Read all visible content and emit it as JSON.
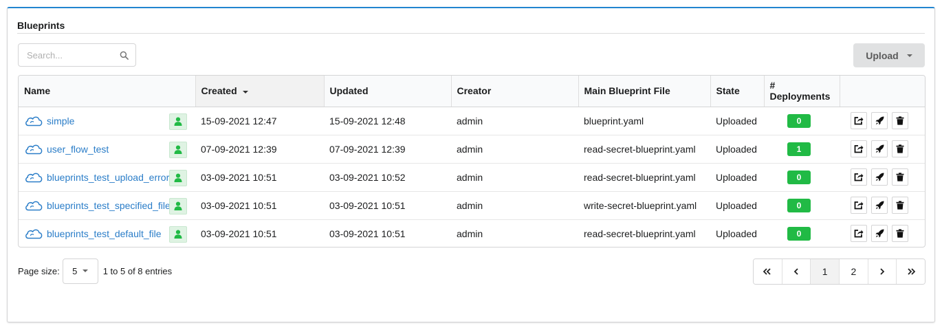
{
  "panel": {
    "title": "Blueprints"
  },
  "search": {
    "placeholder": "Search..."
  },
  "upload": {
    "label": "Upload"
  },
  "table": {
    "columns": [
      "Name",
      "Created",
      "Updated",
      "Creator",
      "Main Blueprint File",
      "State",
      "# Deployments"
    ],
    "sorted_column": "Created",
    "rows": [
      {
        "name": "simple",
        "created": "15-09-2021 12:47",
        "updated": "15-09-2021 12:48",
        "creator": "admin",
        "file": "blueprint.yaml",
        "state": "Uploaded",
        "deployments": "0"
      },
      {
        "name": "user_flow_test",
        "created": "07-09-2021 12:39",
        "updated": "07-09-2021 12:39",
        "creator": "admin",
        "file": "read-secret-blueprint.yaml",
        "state": "Uploaded",
        "deployments": "1"
      },
      {
        "name": "blueprints_test_upload_error",
        "created": "03-09-2021 10:51",
        "updated": "03-09-2021 10:52",
        "creator": "admin",
        "file": "read-secret-blueprint.yaml",
        "state": "Uploaded",
        "deployments": "0"
      },
      {
        "name": "blueprints_test_specified_file",
        "created": "03-09-2021 10:51",
        "updated": "03-09-2021 10:51",
        "creator": "admin",
        "file": "write-secret-blueprint.yaml",
        "state": "Uploaded",
        "deployments": "0"
      },
      {
        "name": "blueprints_test_default_file",
        "created": "03-09-2021 10:51",
        "updated": "03-09-2021 10:51",
        "creator": "admin",
        "file": "read-secret-blueprint.yaml",
        "state": "Uploaded",
        "deployments": "0"
      }
    ]
  },
  "footer": {
    "page_size_label": "Page size:",
    "page_size_value": "5",
    "entries_text": "1 to 5 of 8 entries",
    "pagination": {
      "first": "«",
      "prev": "‹",
      "pages": [
        "1",
        "2"
      ],
      "current_page": "1",
      "next": "›",
      "last": "»"
    }
  },
  "colors": {
    "accent": "#2185d0",
    "link": "#2a7dc8",
    "badge": "#21ba45"
  }
}
